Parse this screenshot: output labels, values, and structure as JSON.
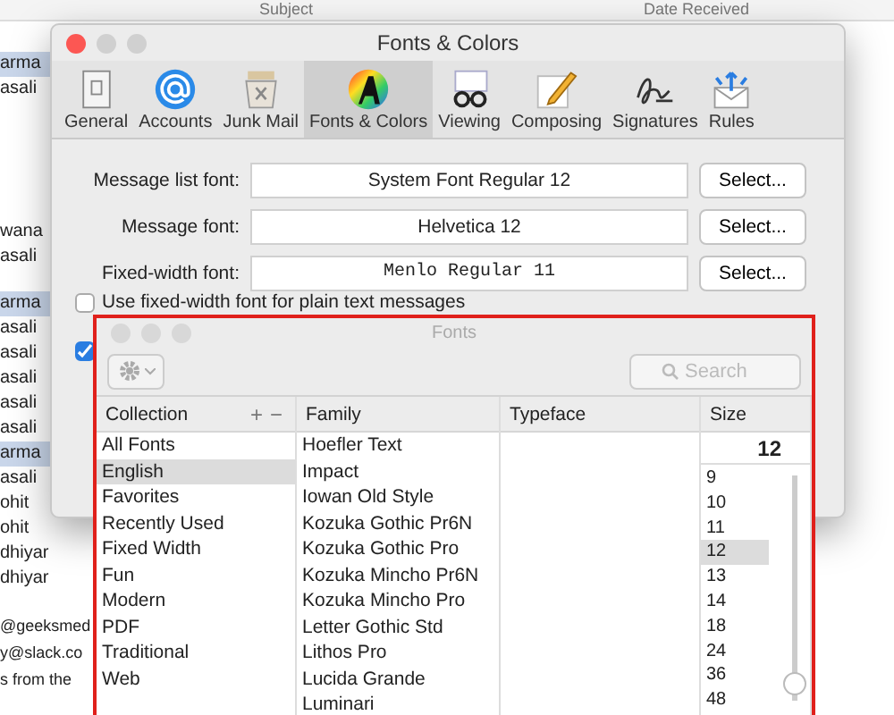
{
  "mail": {
    "columns": [
      "Subject",
      "Date Received"
    ],
    "rows_top": [
      {
        "sender": "arma",
        "selected": true
      },
      {
        "sender": "asali",
        "selected": false
      }
    ],
    "rows_middle": [
      {
        "sender": "wana",
        "selected": false
      },
      {
        "sender": "asali",
        "selected": false
      }
    ],
    "rows_bottom": [
      {
        "sender": "arma",
        "selected": true
      },
      {
        "sender": "asali",
        "selected": false
      },
      {
        "sender": "asali",
        "selected": false
      },
      {
        "sender": "asali",
        "selected": false
      },
      {
        "sender": "asali",
        "selected": false
      },
      {
        "sender": "asali",
        "selected": false
      },
      {
        "sender": "arma",
        "selected": true
      },
      {
        "sender": "asali",
        "selected": false
      },
      {
        "sender": "ohit",
        "selected": false
      },
      {
        "sender": "ohit",
        "selected": false
      },
      {
        "sender": "dhiyar",
        "selected": false
      },
      {
        "sender": "dhiyar",
        "selected": false
      }
    ],
    "preview": [
      "@geeksmed",
      "y@slack.co",
      "s from the"
    ]
  },
  "preferences": {
    "title": "Fonts & Colors",
    "tabs": [
      {
        "label": "General",
        "kind": "general",
        "selected": false
      },
      {
        "label": "Accounts",
        "kind": "accounts",
        "selected": false
      },
      {
        "label": "Junk Mail",
        "kind": "junk",
        "selected": false
      },
      {
        "label": "Fonts & Colors",
        "kind": "fonts",
        "selected": true
      },
      {
        "label": "Viewing",
        "kind": "viewing",
        "selected": false
      },
      {
        "label": "Composing",
        "kind": "composing",
        "selected": false
      },
      {
        "label": "Signatures",
        "kind": "signatures",
        "selected": false
      },
      {
        "label": "Rules",
        "kind": "rules",
        "selected": false
      }
    ],
    "font_rows": [
      {
        "label": "Message list font:",
        "value": "System Font Regular 12",
        "mono": false,
        "button": "Select..."
      },
      {
        "label": "Message font:",
        "value": "Helvetica 12",
        "mono": false,
        "button": "Select..."
      },
      {
        "label": "Fixed-width font:",
        "value": "Menlo Regular 11",
        "mono": true,
        "button": "Select..."
      }
    ],
    "checkboxes": [
      {
        "label": "Use fixed-width font for plain text messages",
        "checked": false
      },
      {
        "checked": true
      }
    ]
  },
  "fonts_panel": {
    "title": "Fonts",
    "search": {
      "placeholder": "Search"
    },
    "columns": {
      "collection": "Collection",
      "add": "+",
      "remove": "−",
      "family": "Family",
      "typeface": "Typeface",
      "size": "Size"
    },
    "collections": [
      {
        "label": "All Fonts",
        "selected": false
      },
      {
        "label": "English",
        "selected": true
      },
      {
        "label": "Favorites",
        "selected": false
      },
      {
        "label": "Recently Used",
        "selected": false
      },
      {
        "label": "Fixed Width",
        "selected": false
      },
      {
        "label": "Fun",
        "selected": false
      },
      {
        "label": "Modern",
        "selected": false
      },
      {
        "label": "PDF",
        "selected": false
      },
      {
        "label": "Traditional",
        "selected": false
      },
      {
        "label": "Web",
        "selected": false
      }
    ],
    "families": [
      "Hoefler Text",
      "Impact",
      "Iowan Old Style",
      "Kozuka Gothic Pr6N",
      "Kozuka Gothic Pro",
      "Kozuka Mincho Pr6N",
      "Kozuka Mincho Pro",
      "Letter Gothic Std",
      "Lithos Pro",
      "Lucida Grande",
      "Luminari"
    ],
    "size_value": "12",
    "sizes": [
      {
        "label": "9",
        "selected": false
      },
      {
        "label": "10",
        "selected": false
      },
      {
        "label": "11",
        "selected": false
      },
      {
        "label": "12",
        "selected": true
      },
      {
        "label": "13",
        "selected": false
      },
      {
        "label": "14",
        "selected": false
      },
      {
        "label": "18",
        "selected": false
      },
      {
        "label": "24",
        "selected": false
      },
      {
        "label": "36",
        "selected": false
      },
      {
        "label": "48",
        "selected": false
      }
    ],
    "size_slider": {
      "level": 0.03
    }
  }
}
